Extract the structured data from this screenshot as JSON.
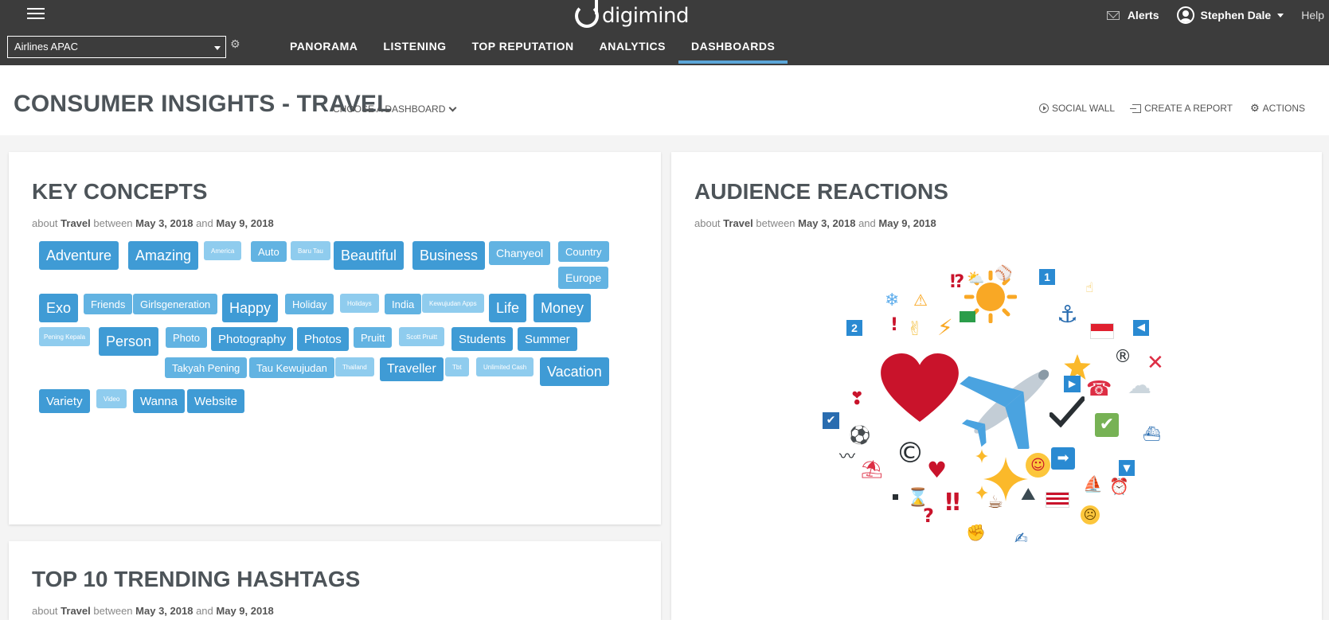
{
  "topbar": {
    "logo_text": "digimind",
    "alerts_label": "Alerts",
    "user_name": "Stephen Dale",
    "help_label": "Help",
    "account_select": "Airlines APAC",
    "nav": [
      "PANORAMA",
      "LISTENING",
      "TOP REPUTATION",
      "ANALYTICS",
      "DASHBOARDS"
    ],
    "active_nav": "DASHBOARDS"
  },
  "header": {
    "title": "CONSUMER INSIGHTS - TRAVEL",
    "choose_dashboard": "CHOOSE A DASHBOARD",
    "actions": {
      "social_wall": "SOCIAL WALL",
      "create_report": "CREATE A REPORT",
      "actions": "ACTIONS"
    }
  },
  "key_concepts": {
    "title": "KEY CONCEPTS",
    "sub_about": "about",
    "sub_topic": "Travel",
    "sub_between": "between",
    "sub_from": "May 3, 2018",
    "sub_and": "and",
    "sub_to": "May 9, 2018",
    "tags": [
      "Adventure",
      "Amazing",
      "America",
      "Auto",
      "Baru Tau",
      "Beautiful",
      "Business",
      "Chanyeol",
      "Country",
      "Europe",
      "Exo",
      "Friends",
      "Girlsgeneration",
      "Happy",
      "Holiday",
      "Holidays",
      "India",
      "Kewujudan Apps",
      "Life",
      "Money",
      "Pening Kepala",
      "Person",
      "Photo",
      "Photography",
      "Photos",
      "Pruitt",
      "Scott Pruitt",
      "Students",
      "Summer",
      "Takyah Pening",
      "Tau Kewujudan",
      "Thailand",
      "Traveller",
      "Tbt",
      "Unlimited Cash",
      "Vacation",
      "Variety",
      "Video",
      "Wanna",
      "Website"
    ]
  },
  "audience_reactions": {
    "title": "AUDIENCE REACTIONS",
    "sub_about": "about",
    "sub_topic": "Travel",
    "sub_between": "between",
    "sub_from": "May 3, 2018",
    "sub_and": "and",
    "sub_to": "May 9, 2018"
  },
  "trending_hashtags": {
    "title": "TOP 10 TRENDING HASHTAGS",
    "sub_about": "about",
    "sub_topic": "Travel",
    "sub_between": "between",
    "sub_from": "May 3, 2018",
    "sub_and": "and",
    "sub_to": "May 9, 2018"
  },
  "colors": {
    "topbar": "#3c3c3c",
    "accent": "#3f9bd5",
    "nav_active": "#5ba6d8"
  }
}
